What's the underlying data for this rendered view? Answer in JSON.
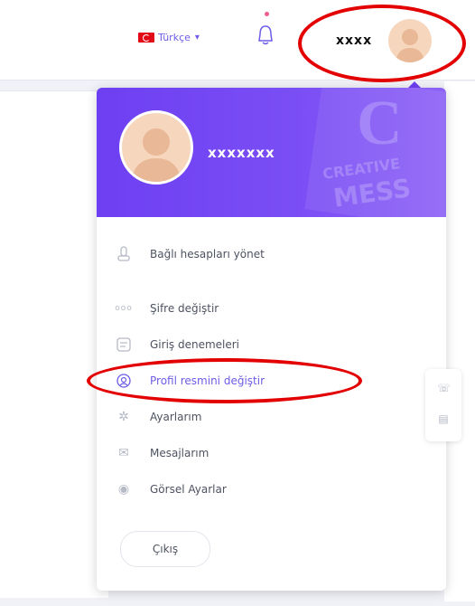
{
  "header": {
    "language": {
      "label": "Türkçe",
      "flag": "turkey-flag-icon"
    },
    "user": {
      "name": "xxxx"
    },
    "colors": {
      "accent": "#6c5ce7",
      "annotation": "#e30000"
    }
  },
  "dropdown": {
    "name": "xxxxxxx",
    "header_bg": "#6d3ff2",
    "decor": {
      "letter": "C",
      "word1": "CREATIVE",
      "word2": "MESS"
    },
    "menu": [
      {
        "label": "Bağlı hesapları yönet",
        "icon": "connected-accounts-icon"
      },
      {
        "label": "Şifre değiştir",
        "icon": "password-icon"
      },
      {
        "label": "Giriş denemeleri",
        "icon": "login-attempts-icon"
      },
      {
        "label": "Profil resmini değiştir",
        "icon": "profile-picture-icon"
      },
      {
        "label": "Ayarlarım",
        "icon": "settings-icon"
      },
      {
        "label": "Mesajlarım",
        "icon": "messages-icon"
      },
      {
        "label": "Görsel Ayarlar",
        "icon": "visual-settings-icon"
      }
    ],
    "logout_label": "Çıkış"
  },
  "side_widget": {
    "items": [
      "whatsapp-icon",
      "chat-icon"
    ]
  }
}
